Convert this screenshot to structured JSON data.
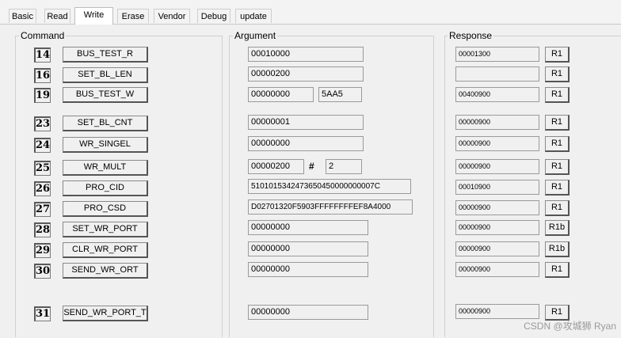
{
  "tabs": [
    "Basic",
    "Read",
    "Write",
    "Erase",
    "Vendor",
    "Debug",
    "update"
  ],
  "active_tab": "Write",
  "groups": {
    "command": "Command",
    "argument": "Argument",
    "response": "Response"
  },
  "rows": [
    {
      "num": "14",
      "cmd": "BUS_TEST_R",
      "arg": "00010000",
      "resp": "00001300",
      "rtype": "R1"
    },
    {
      "num": "16",
      "cmd": "SET_BL_LEN",
      "arg": "00000200",
      "resp": "",
      "rtype": "R1"
    },
    {
      "num": "19",
      "cmd": "BUS_TEST_W",
      "arg": "00000000",
      "arg2": "5AA5",
      "resp": "00400900",
      "rtype": "R1"
    },
    {
      "num": "23",
      "cmd": "SET_BL_CNT",
      "arg": "00000001",
      "resp": "00000900",
      "rtype": "R1"
    },
    {
      "num": "24",
      "cmd": "WR_SINGEL",
      "arg": "00000000",
      "resp": "00000900",
      "rtype": "R1"
    },
    {
      "num": "25",
      "cmd": "WR_MULT",
      "arg": "00000200",
      "hash": "#",
      "arg2": "2",
      "resp": "00000900",
      "rtype": "R1"
    },
    {
      "num": "26",
      "cmd": "PRO_CID",
      "arg": "5101015342473650450000000007C",
      "resp": "00010900",
      "rtype": "R1"
    },
    {
      "num": "27",
      "cmd": "PRO_CSD",
      "arg": "D02701320F5903FFFFFFFFEF8A4000",
      "resp": "00000900",
      "rtype": "R1"
    },
    {
      "num": "28",
      "cmd": "SET_WR_PORT",
      "arg": "00000000",
      "resp": "00000900",
      "rtype": "R1b"
    },
    {
      "num": "29",
      "cmd": "CLR_WR_PORT",
      "arg": "00000000",
      "resp": "00000900",
      "rtype": "R1b"
    },
    {
      "num": "30",
      "cmd": "SEND_WR_ORT",
      "arg": "00000000",
      "resp": "00000900",
      "rtype": "R1"
    },
    {
      "num": "31",
      "cmd": "SEND_WR_PORT_T",
      "arg": "00000000",
      "resp": "00000900",
      "rtype": "R1"
    }
  ],
  "watermark": "CSDN @攻城狮 Ryan"
}
